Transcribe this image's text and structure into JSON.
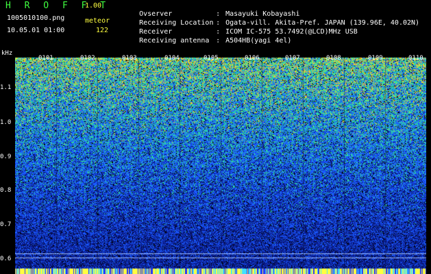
{
  "app": {
    "title": "H R O F F T",
    "version": "1.00"
  },
  "file": {
    "name": "1005010100.png",
    "datetime": "10.05.01 01:00"
  },
  "meteor": {
    "label": "meteor",
    "count": "122"
  },
  "info": [
    {
      "label": "Ovserver",
      "value": "Masayuki Kobayashi"
    },
    {
      "label": "Receiving Location",
      "value": "Ogata-vill. Akita-Pref. JAPAN (139.96E, 40.02N)"
    },
    {
      "label": "Receiver",
      "value": "ICOM IC-575 53.7492(@LCD)MHz USB"
    },
    {
      "label": "Receiving antenna",
      "value": "A504HB(yagi 4el)"
    }
  ],
  "separator": ":",
  "spectrogram": {
    "y_unit": "kHz",
    "y_ticks": [
      "1.1",
      "1.0",
      "0.9",
      "0.8",
      "0.7",
      "0.6"
    ],
    "x_ticks": [
      "0101",
      "0102",
      "0103",
      "0104",
      "0105",
      "0106",
      "0107",
      "0108",
      "0109",
      "0110"
    ],
    "colors": {
      "low": "#0a1a8a",
      "mid": "#1a5aff",
      "high": "#30e0a0",
      "peak": "#ffd020",
      "title": "#40ff40",
      "meteor": "#ffff40"
    }
  }
}
